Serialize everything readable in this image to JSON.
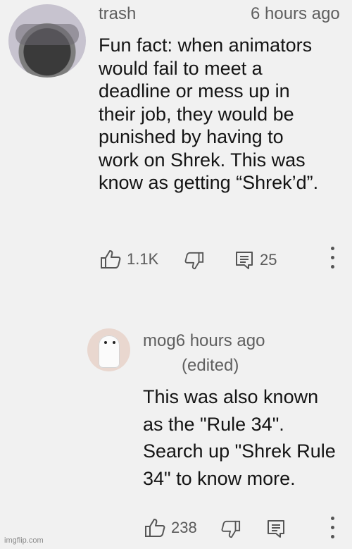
{
  "comment": {
    "username": "trash",
    "timestamp": "6 hours ago",
    "lines": [
      "Fun fact: when animators",
      "would fail to meet a",
      "deadline or mess up in",
      "their job, they would be",
      "punished by having to",
      "work on Shrek. This was",
      "know as getting “Shrek’d”."
    ],
    "like_count": "1.1K",
    "reply_count": "25"
  },
  "reply": {
    "username_time": "mog6 hours ago",
    "edited": "(edited)",
    "lines": [
      "This was also known",
      "as the \"Rule 34\".",
      "Search up \"Shrek Rule",
      "34\" to know more."
    ],
    "like_count": "238"
  },
  "watermark": "imgflip.com",
  "colors": {
    "background": "#f1f1f1",
    "text": "#141414",
    "meta_text": "#5f5f5f",
    "icon": "#555555"
  },
  "icons": [
    "thumbs-up-icon",
    "thumbs-down-icon",
    "reply-icon",
    "more-vert-icon"
  ]
}
